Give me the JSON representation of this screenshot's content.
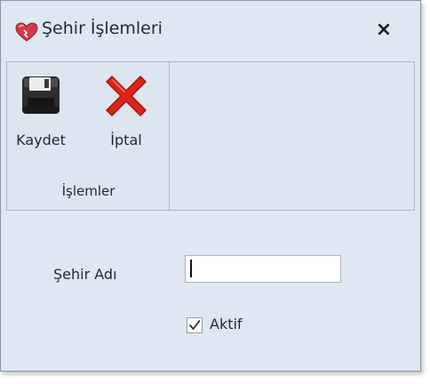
{
  "window": {
    "title": "Şehir İşlemleri",
    "close_label": "×"
  },
  "ribbon": {
    "group_label": "İşlemler",
    "buttons": [
      {
        "label": "Kaydet",
        "icon": "floppy-disk-icon"
      },
      {
        "label": "İptal",
        "icon": "red-x-icon"
      }
    ]
  },
  "form": {
    "city_name_label": "Şehir Adı",
    "city_name_value": "",
    "active_label": "Aktif",
    "active_checked": true
  },
  "colors": {
    "window_bg": "#dfe7f2",
    "cancel_red": "#d9251b",
    "heart_red": "#d33a4a"
  }
}
